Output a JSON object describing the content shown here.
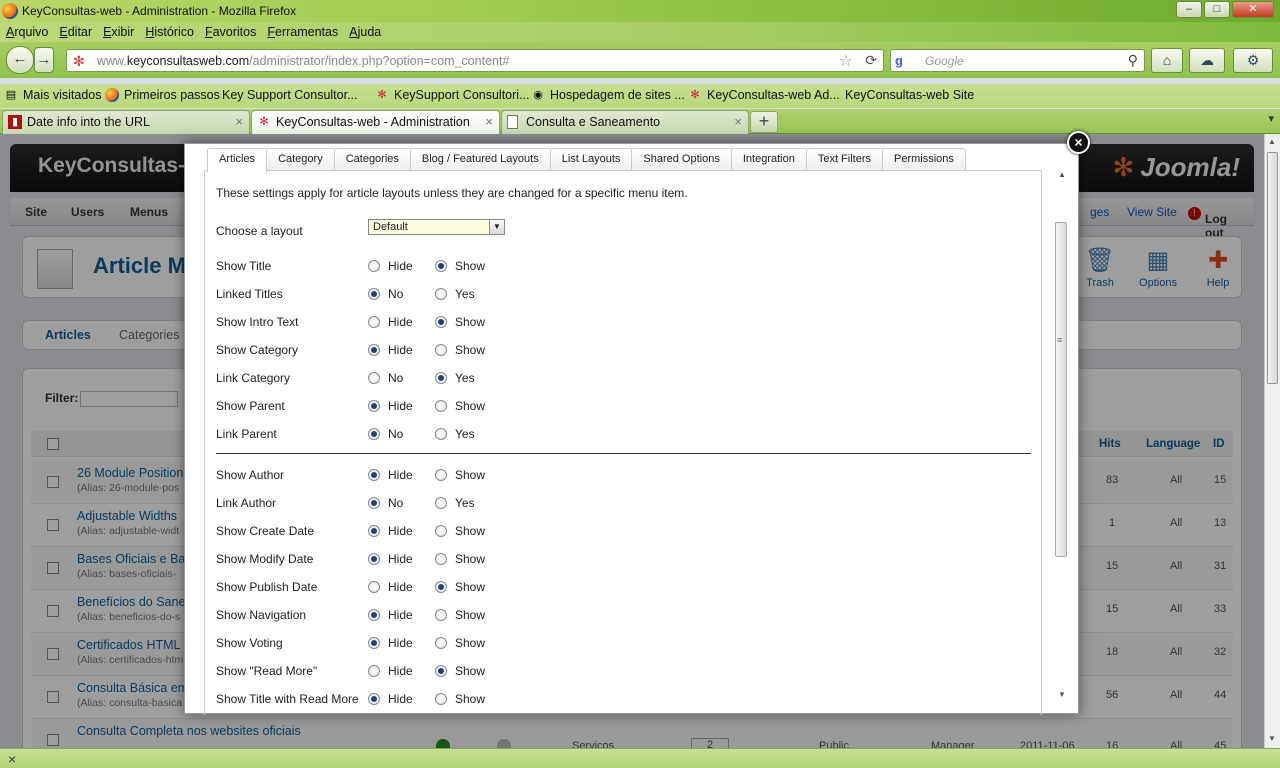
{
  "window": {
    "title": "KeyConsultas-web - Administration - Mozilla Firefox",
    "minimize": "–",
    "maximize": "□",
    "close": "✕"
  },
  "menubar": [
    "Arquivo",
    "Editar",
    "Exibir",
    "Histórico",
    "Favoritos",
    "Ferramentas",
    "Ajuda"
  ],
  "navbar": {
    "back": "←",
    "forward": "→",
    "url_prefix": "www.",
    "url_domain": "keyconsultasweb.com",
    "url_path": "/administrator/index.php?option=com_content#",
    "search_engine": "g",
    "search_placeholder": "Google",
    "home": "⌂"
  },
  "bookmarks": [
    {
      "label": "Mais visitados",
      "icon": "bars-icon"
    },
    {
      "label": "Primeiros passos",
      "icon": "firefox-icon"
    },
    {
      "label": "Key Support Consultor...",
      "icon": "page-icon"
    },
    {
      "label": "KeySupport Consultori...",
      "icon": "joomla-icon"
    },
    {
      "label": "Hospedagem de sites ...",
      "icon": "globe-icon"
    },
    {
      "label": "KeyConsultas-web Ad...",
      "icon": "joomla-icon"
    },
    {
      "label": "KeyConsultas-web Site",
      "icon": "page-icon"
    }
  ],
  "tabs": [
    {
      "label": "Date info into the URL",
      "active": false
    },
    {
      "label": "KeyConsultas-web - Administration",
      "active": true
    },
    {
      "label": "Consulta e Saneamento",
      "active": false
    }
  ],
  "page": {
    "site_name": "KeyConsultas-w",
    "brand": "Joomla!",
    "menu": [
      "Site",
      "Users",
      "Menus"
    ],
    "menu_right": {
      "pages": "ges",
      "view_site": "View Site",
      "logout": "Log out"
    },
    "page_title": "Article Ma",
    "toolbar": [
      {
        "label": "Trash",
        "icon": "trash-icon"
      },
      {
        "label": "Options",
        "icon": "options-icon"
      },
      {
        "label": "Help",
        "icon": "help-icon"
      }
    ],
    "submenu": {
      "articles": "Articles",
      "categories": "Categories"
    },
    "filter_label": "Filter:",
    "columns": {
      "hits": "Hits",
      "language": "Language",
      "id": "ID"
    },
    "rows": [
      {
        "title": "26 Module Positions",
        "alias": "(Alias: 26-module-pos",
        "hits": "83",
        "language": "All",
        "id": "15"
      },
      {
        "title": "Adjustable Widths",
        "alias": "(Alias: adjustable-widt",
        "hits": "1",
        "language": "All",
        "id": "13"
      },
      {
        "title": "Bases Oficiais e Ba",
        "alias": "(Alias: bases-oficiais-",
        "hits": "15",
        "language": "All",
        "id": "31"
      },
      {
        "title": "Benefícios do Sane",
        "alias": "(Alias: beneficios-do-s",
        "hits": "15",
        "language": "All",
        "id": "33"
      },
      {
        "title": "Certificados HTML o",
        "alias": "(Alias: certificados-htm",
        "hits": "18",
        "language": "All",
        "id": "32"
      },
      {
        "title": "Consulta Básica em",
        "alias": "(Alias: consulta-basica",
        "hits": "56",
        "language": "All",
        "id": "44"
      },
      {
        "title": "Consulta Completa nos websites oficiais",
        "alias": "",
        "hits": "16",
        "language": "All",
        "id": "45"
      }
    ],
    "last_row_extra": {
      "category": "Servicos",
      "order": "2",
      "access": "Public",
      "author": "Manager",
      "date": "2011-11-06"
    }
  },
  "modal": {
    "close": "×",
    "tabs": [
      "Articles",
      "Category",
      "Categories",
      "Blog / Featured Layouts",
      "List Layouts",
      "Shared Options",
      "Integration",
      "Text Filters",
      "Permissions"
    ],
    "active_tab": "Articles",
    "description": "These settings apply for article layouts unless they are changed for a specific menu item.",
    "layout_label": "Choose a layout",
    "layout_value": "Default",
    "group1": [
      {
        "label": "Show Title",
        "opt1": "Hide",
        "opt2": "Show",
        "selected": 2
      },
      {
        "label": "Linked Titles",
        "opt1": "No",
        "opt2": "Yes",
        "selected": 1
      },
      {
        "label": "Show Intro Text",
        "opt1": "Hide",
        "opt2": "Show",
        "selected": 2
      },
      {
        "label": "Show Category",
        "opt1": "Hide",
        "opt2": "Show",
        "selected": 1
      },
      {
        "label": "Link Category",
        "opt1": "No",
        "opt2": "Yes",
        "selected": 2
      },
      {
        "label": "Show Parent",
        "opt1": "Hide",
        "opt2": "Show",
        "selected": 1
      },
      {
        "label": "Link Parent",
        "opt1": "No",
        "opt2": "Yes",
        "selected": 1
      }
    ],
    "group2": [
      {
        "label": "Show Author",
        "opt1": "Hide",
        "opt2": "Show",
        "selected": 1
      },
      {
        "label": "Link Author",
        "opt1": "No",
        "opt2": "Yes",
        "selected": 1
      },
      {
        "label": "Show Create Date",
        "opt1": "Hide",
        "opt2": "Show",
        "selected": 1
      },
      {
        "label": "Show Modify Date",
        "opt1": "Hide",
        "opt2": "Show",
        "selected": 1
      },
      {
        "label": "Show Publish Date",
        "opt1": "Hide",
        "opt2": "Show",
        "selected": 2
      },
      {
        "label": "Show Navigation",
        "opt1": "Hide",
        "opt2": "Show",
        "selected": 1
      },
      {
        "label": "Show Voting",
        "opt1": "Hide",
        "opt2": "Show",
        "selected": 1
      },
      {
        "label": "Show \"Read More\"",
        "opt1": "Hide",
        "opt2": "Show",
        "selected": 2
      },
      {
        "label": "Show Title with Read More",
        "opt1": "Hide",
        "opt2": "Show",
        "selected": 1
      }
    ]
  }
}
